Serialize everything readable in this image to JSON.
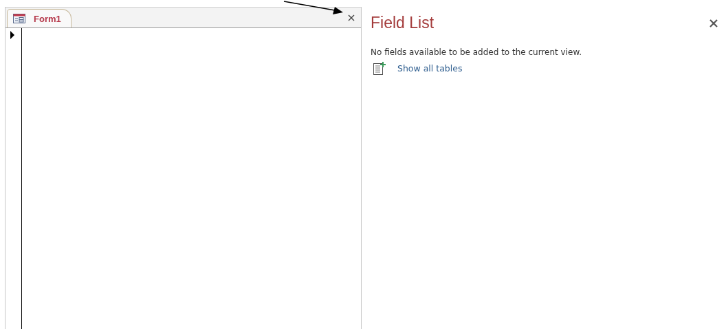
{
  "document": {
    "tabs": [
      {
        "label": "Form1",
        "selected": true
      }
    ]
  },
  "field_list": {
    "title": "Field List",
    "message": "No fields available to be added to the current view.",
    "link": "Show all tables"
  }
}
